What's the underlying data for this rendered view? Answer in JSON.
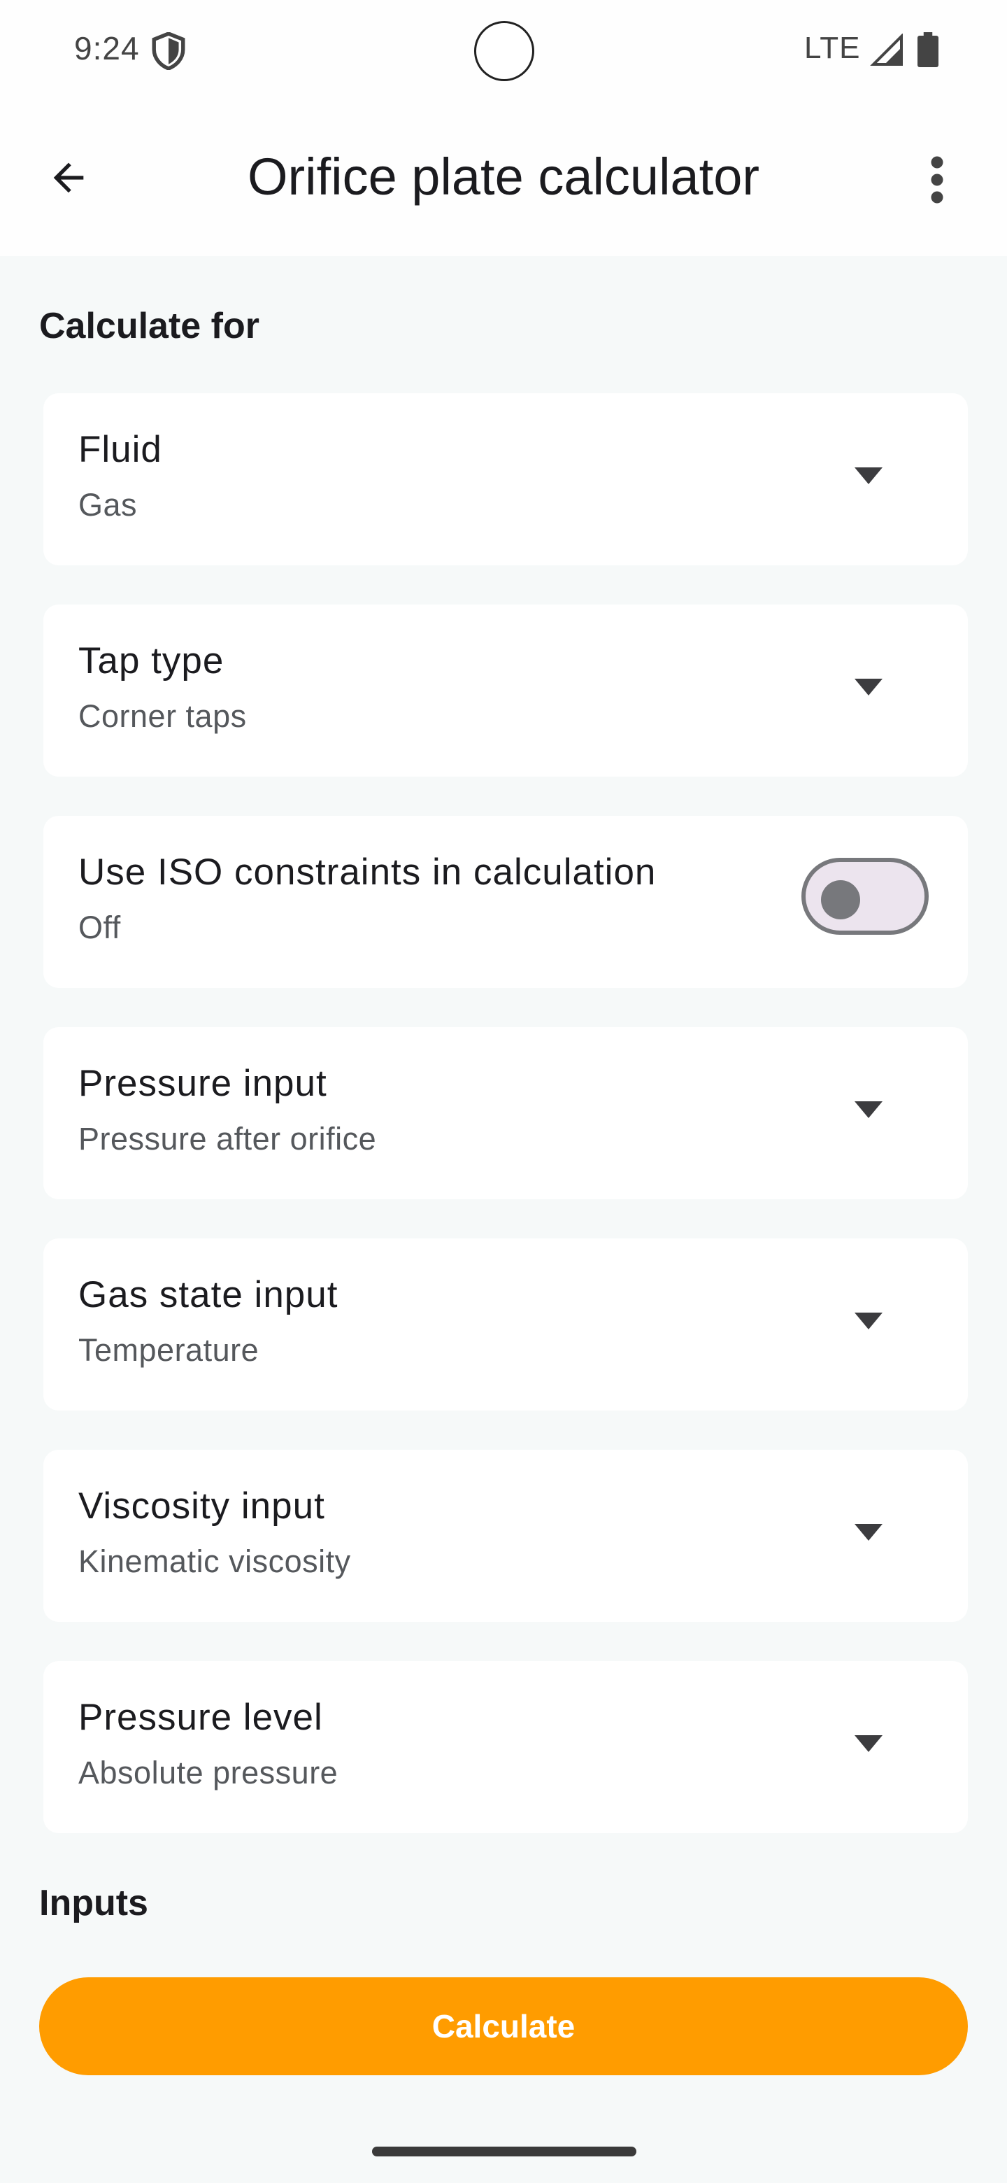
{
  "status_bar": {
    "time": "9:24",
    "network": "LTE"
  },
  "app_bar": {
    "title": "Orifice plate calculator",
    "back_icon": "arrow-back-icon",
    "menu_icon": "more-vert-icon"
  },
  "sections": {
    "calculate_for": "Calculate for",
    "inputs": "Inputs"
  },
  "settings": [
    {
      "label": "Fluid",
      "value": "Gas",
      "control": "dropdown"
    },
    {
      "label": "Tap type",
      "value": "Corner taps",
      "control": "dropdown"
    },
    {
      "label": "Use ISO constraints in calculation",
      "value": "Off",
      "control": "toggle",
      "enabled": false
    },
    {
      "label": "Pressure input",
      "value": "Pressure after orifice",
      "control": "dropdown"
    },
    {
      "label": "Gas state input",
      "value": "Temperature",
      "control": "dropdown"
    },
    {
      "label": "Viscosity input",
      "value": "Kinematic viscosity",
      "control": "dropdown"
    },
    {
      "label": "Pressure level",
      "value": "Absolute pressure",
      "control": "dropdown"
    }
  ],
  "actions": {
    "calculate_label": "Calculate"
  },
  "colors": {
    "accent": "#ff9c00",
    "background": "#f6f9f9",
    "card": "#ffffff"
  }
}
